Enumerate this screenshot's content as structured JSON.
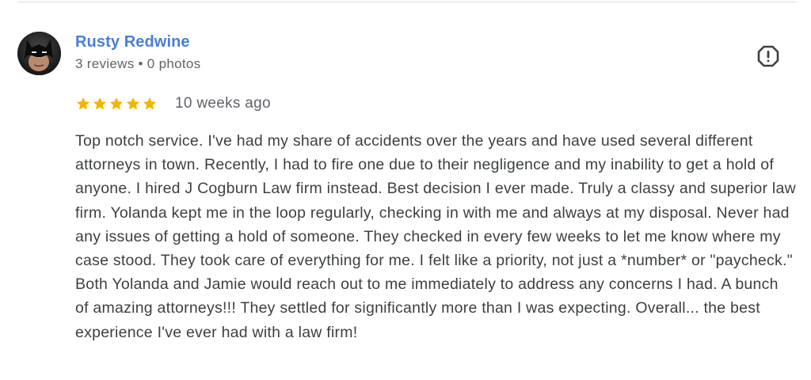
{
  "review": {
    "author": {
      "name": "Rusty Redwine",
      "meta": "3 reviews • 0 photos"
    },
    "rating": {
      "value": 5,
      "max": 5,
      "star_color": "#f4b400"
    },
    "date": "10 weeks ago",
    "text": "Top notch service. I've had my share of accidents over the years and have used several different attorneys in town. Recently, I had to fire one due to their negligence and my inability to get a hold of anyone. I hired J Cogburn Law firm instead. Best decision I ever made. Truly a classy and superior law firm. Yolanda kept me in the loop regularly, checking in with me and always at my disposal. Never had any issues of getting a hold of someone. They checked in every few weeks to let me know where my case stood. They took care of everything for me. I felt like a priority, not just a *number* or \"paycheck.\" Both Yolanda and Jamie would reach out to me immediately to address any concerns I had. A bunch of amazing attorneys!!! They settled for significantly more than I was expecting. Overall... the best experience I've ever had with a law firm!",
    "report_icon": "report-flag-icon"
  },
  "colors": {
    "name_link": "#4a7ed6",
    "meta_text": "#5f6368",
    "body_text": "#3c4043",
    "divider": "#dadce0"
  }
}
